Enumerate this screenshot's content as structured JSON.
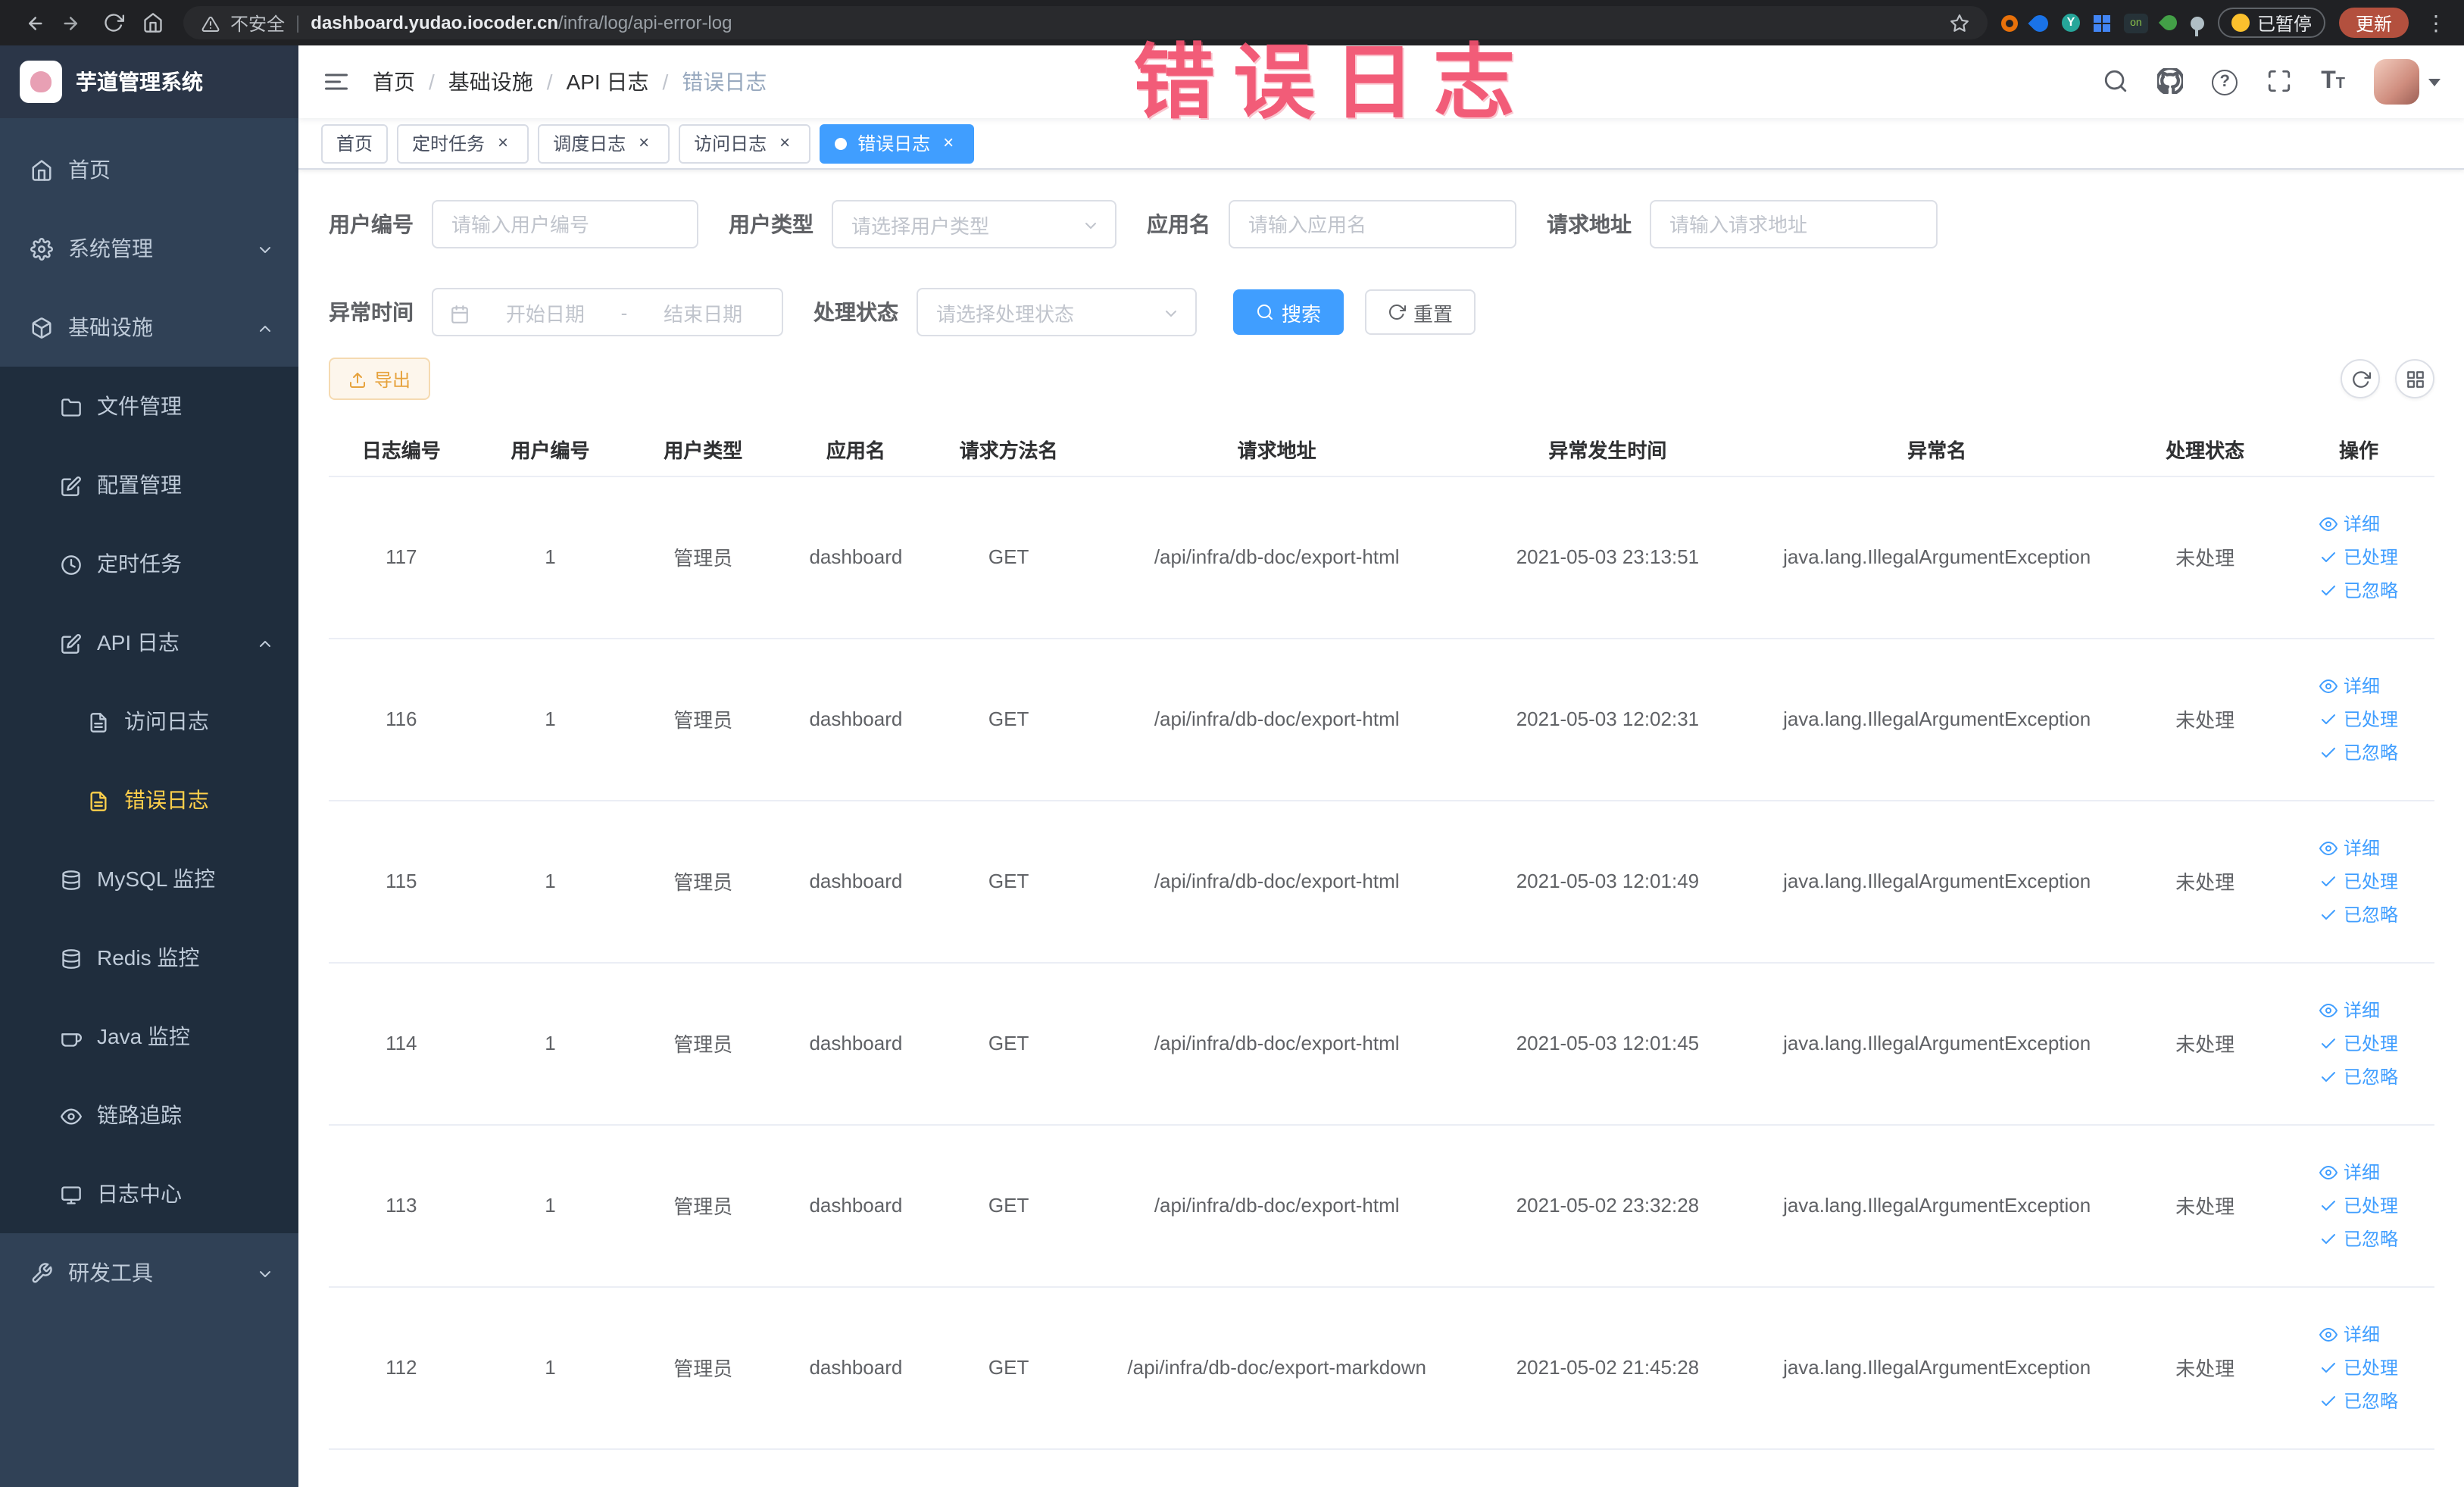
{
  "browser": {
    "security_chip": "不安全",
    "url_domain": "dashboard.yudao.iocoder.cn",
    "url_path": "/infra/log/api-error-log",
    "extension_on_badge": "on",
    "paused_button": "已暂停",
    "update_button": "更新"
  },
  "glyphs": {
    "omnibox_separator": "|",
    "breadcrumb_separator": "/",
    "tab_close": "×",
    "kebab": "⋮",
    "question": "?",
    "font_size_big": "T",
    "font_size_small": "T"
  },
  "annotation": {
    "text": "错误日志"
  },
  "sidebar": {
    "logo_title": "芋道管理系统",
    "home": "首页",
    "system_mgmt": "系统管理",
    "infrastructure": "基础设施",
    "file_mgmt": "文件管理",
    "config_mgmt": "配置管理",
    "scheduled_job": "定时任务",
    "api_log": "API 日志",
    "access_log": "访问日志",
    "error_log": "错误日志",
    "mysql_monitor": "MySQL 监控",
    "redis_monitor": "Redis 监控",
    "java_monitor": "Java 监控",
    "trace": "链路追踪",
    "log_center": "日志中心",
    "dev_tools": "研发工具"
  },
  "header": {
    "breadcrumb": [
      "首页",
      "基础设施",
      "API 日志",
      "错误日志"
    ]
  },
  "tabs": [
    {
      "label": "首页",
      "closable": false,
      "active": false
    },
    {
      "label": "定时任务",
      "closable": true,
      "active": false
    },
    {
      "label": "调度日志",
      "closable": true,
      "active": false
    },
    {
      "label": "访问日志",
      "closable": true,
      "active": false
    },
    {
      "label": "错误日志",
      "closable": true,
      "active": true
    }
  ],
  "filters": {
    "user_id_label": "用户编号",
    "user_id_placeholder": "请输入用户编号",
    "user_type_label": "用户类型",
    "user_type_placeholder": "请选择用户类型",
    "app_name_label": "应用名",
    "app_name_placeholder": "请输入应用名",
    "request_url_label": "请求地址",
    "request_url_placeholder": "请输入请求地址",
    "exception_time_label": "异常时间",
    "date_start_placeholder": "开始日期",
    "date_separator": "-",
    "date_end_placeholder": "结束日期",
    "process_status_label": "处理状态",
    "process_status_placeholder": "请选择处理状态",
    "search_button": "搜索",
    "reset_button": "重置"
  },
  "toolbar": {
    "export_button": "导出"
  },
  "table": {
    "columns": [
      "日志编号",
      "用户编号",
      "用户类型",
      "应用名",
      "请求方法名",
      "请求地址",
      "异常发生时间",
      "异常名",
      "处理状态",
      "操作"
    ],
    "actions": [
      "详细",
      "已处理",
      "已忽略"
    ],
    "rows": [
      {
        "log_id": "117",
        "user_id": "1",
        "user_type": "管理员",
        "app_name": "dashboard",
        "method": "GET",
        "request_url": "/api/infra/db-doc/export-html",
        "time": "2021-05-03 23:13:51",
        "exception": "java.lang.IllegalArgumentException",
        "status": "未处理"
      },
      {
        "log_id": "116",
        "user_id": "1",
        "user_type": "管理员",
        "app_name": "dashboard",
        "method": "GET",
        "request_url": "/api/infra/db-doc/export-html",
        "time": "2021-05-03 12:02:31",
        "exception": "java.lang.IllegalArgumentException",
        "status": "未处理"
      },
      {
        "log_id": "115",
        "user_id": "1",
        "user_type": "管理员",
        "app_name": "dashboard",
        "method": "GET",
        "request_url": "/api/infra/db-doc/export-html",
        "time": "2021-05-03 12:01:49",
        "exception": "java.lang.IllegalArgumentException",
        "status": "未处理"
      },
      {
        "log_id": "114",
        "user_id": "1",
        "user_type": "管理员",
        "app_name": "dashboard",
        "method": "GET",
        "request_url": "/api/infra/db-doc/export-html",
        "time": "2021-05-03 12:01:45",
        "exception": "java.lang.IllegalArgumentException",
        "status": "未处理"
      },
      {
        "log_id": "113",
        "user_id": "1",
        "user_type": "管理员",
        "app_name": "dashboard",
        "method": "GET",
        "request_url": "/api/infra/db-doc/export-html",
        "time": "2021-05-02 23:32:28",
        "exception": "java.lang.IllegalArgumentException",
        "status": "未处理"
      },
      {
        "log_id": "112",
        "user_id": "1",
        "user_type": "管理员",
        "app_name": "dashboard",
        "method": "GET",
        "request_url": "/api/infra/db-doc/export-markdown",
        "time": "2021-05-02 21:45:28",
        "exception": "java.lang.IllegalArgumentException",
        "status": "未处理"
      }
    ]
  },
  "icons": {
    "browser": [
      "back-icon",
      "forward-icon",
      "reload-icon",
      "home-icon",
      "warning-icon",
      "star-icon",
      "extension-icons",
      "kebab-icon"
    ],
    "header": [
      "hamburger-icon",
      "search-icon",
      "github-icon",
      "help-icon",
      "fullscreen-icon",
      "font-size-icon"
    ],
    "table_toolbar": [
      "export-icon",
      "refresh-icon",
      "columns-icon"
    ],
    "row_actions": [
      "eye-icon",
      "check-icon"
    ]
  },
  "colors": {
    "accent_blue": "#409eff",
    "sidebar_bg": "#304156",
    "sidebar_submenu_bg": "#1f2d3d",
    "active_menu_yellow": "#ffd04b",
    "annotation_red": "#f2506e",
    "warning_orange": "#e6a23c"
  }
}
